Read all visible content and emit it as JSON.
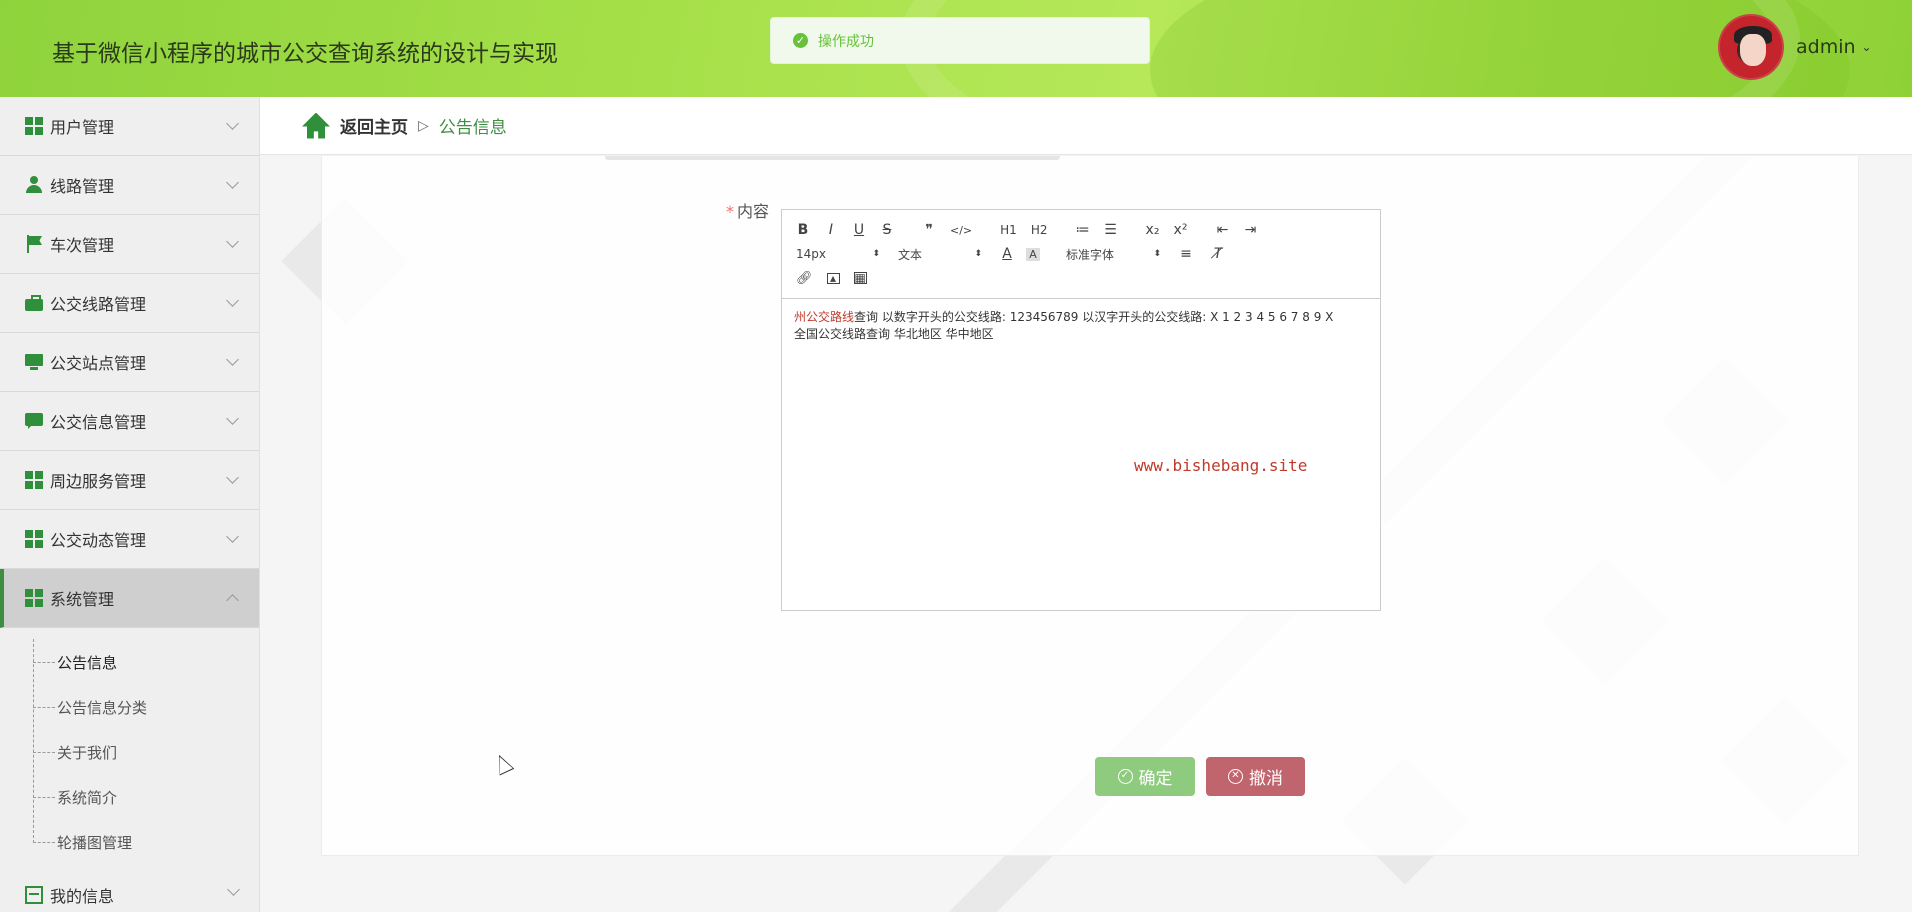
{
  "header": {
    "title": "基于微信小程序的城市公交查询系统的设计与实现",
    "user": "admin"
  },
  "toast": {
    "message": "操作成功"
  },
  "sidebar": {
    "items": [
      {
        "label": "用户管理",
        "icon": "grid-icon"
      },
      {
        "label": "线路管理",
        "icon": "user-icon"
      },
      {
        "label": "车次管理",
        "icon": "flag-icon"
      },
      {
        "label": "公交线路管理",
        "icon": "briefcase-icon"
      },
      {
        "label": "公交站点管理",
        "icon": "monitor-icon"
      },
      {
        "label": "公交信息管理",
        "icon": "chat-icon"
      },
      {
        "label": "周边服务管理",
        "icon": "grid-icon"
      },
      {
        "label": "公交动态管理",
        "icon": "grid-icon"
      },
      {
        "label": "系统管理",
        "icon": "grid-icon",
        "expanded": true
      }
    ],
    "submenu": [
      "公告信息",
      "公告信息分类",
      "关于我们",
      "系统简介",
      "轮播图管理"
    ],
    "myinfo": "我的信息"
  },
  "breadcrumb": {
    "home": "返回主页",
    "separator": "▷",
    "current": "公告信息"
  },
  "form": {
    "content_label": "内容",
    "required_mark": "*"
  },
  "editor": {
    "toolbar_row1": [
      "B",
      "I",
      "U",
      "S",
      "❞",
      "</>",
      "H1",
      "H2",
      "≔",
      "☰",
      "x₂",
      "x²",
      "⇤",
      "⇥"
    ],
    "font_size": "14px",
    "block_type": "文本",
    "font_family": "标准字体",
    "content_red": "州公交路线",
    "content_line1": "查询 以数字开头的公交线路: 123456789 以汉字开头的公交线路: X 1 2 3 4 5 6 7 8 9 X",
    "content_line2": "全国公交线路查询 华北地区 华中地区"
  },
  "watermark": "www.bishebang.site",
  "buttons": {
    "ok": "确定",
    "cancel": "撤消"
  },
  "colors": {
    "accent": "#3e8e41",
    "header": "#a6e049",
    "ok": "#8fcb7f",
    "cancel": "#c0646e",
    "toast": "#67c23a"
  }
}
